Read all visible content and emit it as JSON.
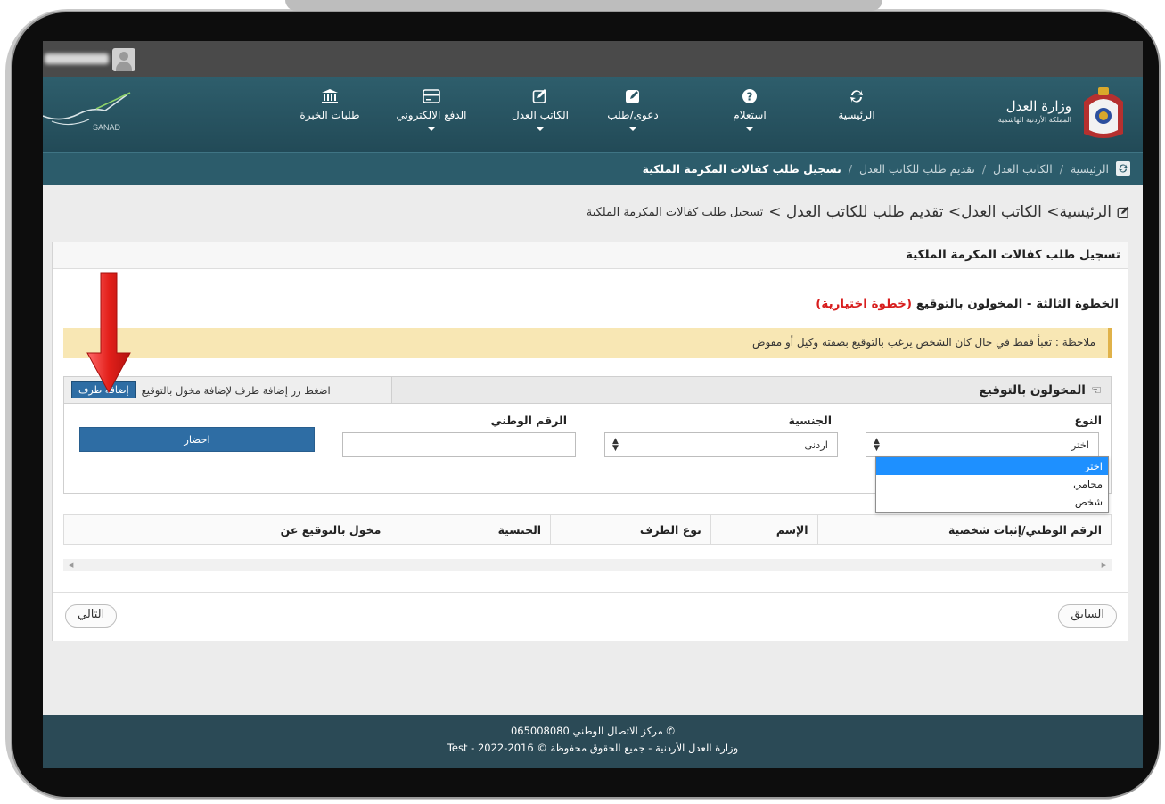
{
  "colors": {
    "nav_bg": "#2e5e6c",
    "primary_button": "#2e6da4",
    "alert_bg": "#f8e7b4",
    "optional_red": "#d81e1e",
    "footer_bg": "#2b4a56",
    "selected_option": "#1e90ff"
  },
  "navbar": {
    "brand_caption": "SANAD",
    "logo_line1": "وزارة العدل",
    "logo_line2": "المملكة الأردنية الهاشمية",
    "items": [
      {
        "label": "الرئيسية",
        "icon": "refresh-icon",
        "has_caret": false
      },
      {
        "label": "استعلام",
        "icon": "question-icon",
        "has_caret": true
      },
      {
        "label": "دعوى/طلب",
        "icon": "edit-icon",
        "has_caret": true
      },
      {
        "label": "الكاتب العدل",
        "icon": "edit-outline-icon",
        "has_caret": true
      },
      {
        "label": "الدفع الالكتروني",
        "icon": "credit-card-icon",
        "has_caret": true
      },
      {
        "label": "طلبات الخبرة",
        "icon": "bank-icon",
        "has_caret": false
      }
    ]
  },
  "breadcrumb": {
    "items": [
      "الرئيسية",
      "الكاتب العدل",
      "تقديم طلب للكاتب العدل"
    ],
    "current": "تسجيل طلب كفالات المكرمة الملكية",
    "separator": "/"
  },
  "page_title": {
    "prefix": "الرئيسية> الكاتب العدل> تقديم طلب للكاتب العدل >",
    "suffix": "تسجيل طلب كفالات المكرمة الملكية"
  },
  "panel": {
    "heading": "تسجيل طلب كفالات المكرمة الملكية",
    "step_title": "الخطوة الثالثة - المخولون بالتوقيع",
    "step_optional": "(خطوة اختيارية)",
    "note": "ملاحظة : تعبأ فقط في حال كان الشخص يرغب بالتوقيع بصفته وكيل أو مفوض"
  },
  "signers": {
    "title": "المخولون بالتوقيع",
    "hint": "اضغط زر إضافة طرف لإضافة مخول بالتوقيع",
    "add_button": "إضافة طرف",
    "type_label": "النوع",
    "type_value": "اختر",
    "type_options": [
      "اختر",
      "محامي",
      "شخص"
    ],
    "type_selected_index": 0,
    "nationality_label": "الجنسية",
    "nationality_value": "اردنى",
    "national_id_label": "الرقم الوطني",
    "national_id_value": "",
    "fetch_button": "احضار"
  },
  "table": {
    "columns": [
      "الرقم الوطني/إثبات شخصية",
      "الإسم",
      "نوع الطرف",
      "الجنسية",
      "مخول بالتوقيع عن"
    ]
  },
  "nav_buttons": {
    "previous": "السابق",
    "next": "التالي"
  },
  "footer": {
    "contact": "مركز الاتصال الوطني 065008080",
    "copyright": "وزارة العدل الأردنية - جميع الحقوق محفوظة © 2016-2022 - Test"
  }
}
